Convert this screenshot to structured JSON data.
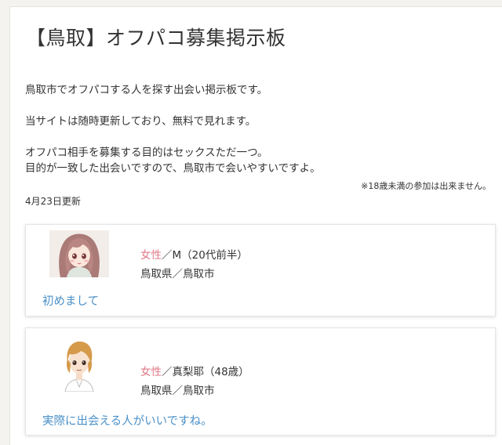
{
  "page": {
    "title": "【鳥取】オフパコ募集掲示板",
    "intro": [
      "鳥取市でオフパコする人を探す出会い掲示板です。",
      "当サイトは随時更新しており、無料で見れます。",
      "オフパコ相手を募集する目的はセックスただ一つ。",
      "目的が一致した出会いですので、鳥取市で会いやすいですよ。"
    ],
    "notice": "※18歳未満の参加は出来ません。",
    "updated": "4月23日更新"
  },
  "posts": [
    {
      "gender": "女性",
      "sep": "／",
      "name_age": "M（20代前半）",
      "location": "鳥取県／鳥取市",
      "message": "初めまして",
      "avatar_icon": "anime-girl-pink-hair-avatar"
    },
    {
      "gender": "女性",
      "sep": "／",
      "name_age": "真梨耶（48歳）",
      "location": "鳥取県／鳥取市",
      "message": "実際に出会える人がいいですね。",
      "avatar_icon": "anime-woman-blonde-short-hair-avatar"
    }
  ],
  "colors": {
    "gender": "#e07a88",
    "message": "#4a90c8",
    "background": "#f4f3ef"
  }
}
